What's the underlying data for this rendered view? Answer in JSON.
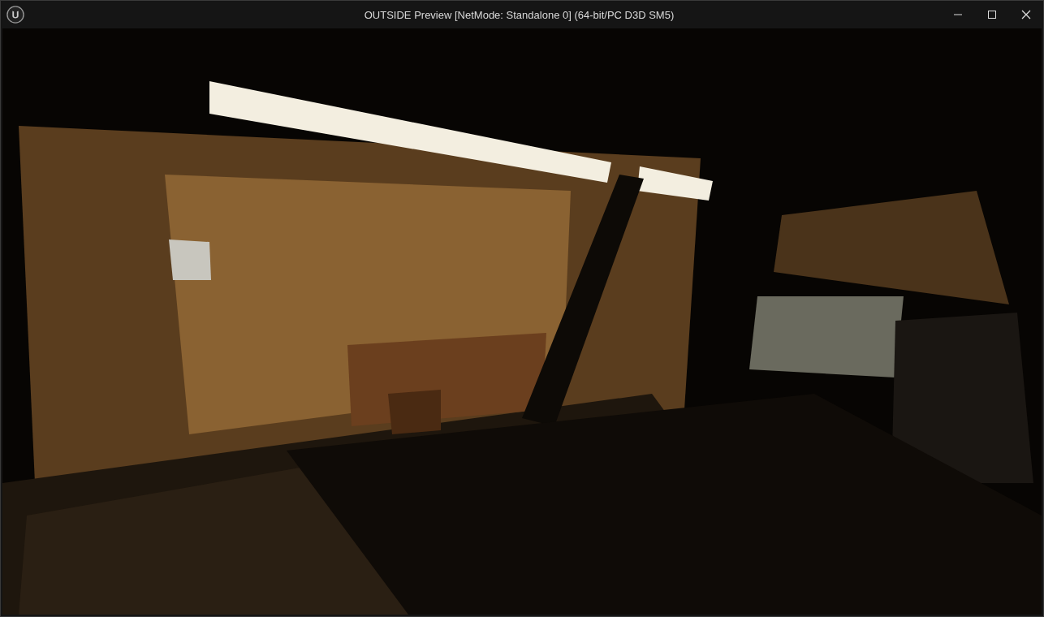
{
  "window": {
    "title": "OUTSIDE Preview [NetMode: Standalone 0]  (64-bit/PC D3D SM5)"
  }
}
